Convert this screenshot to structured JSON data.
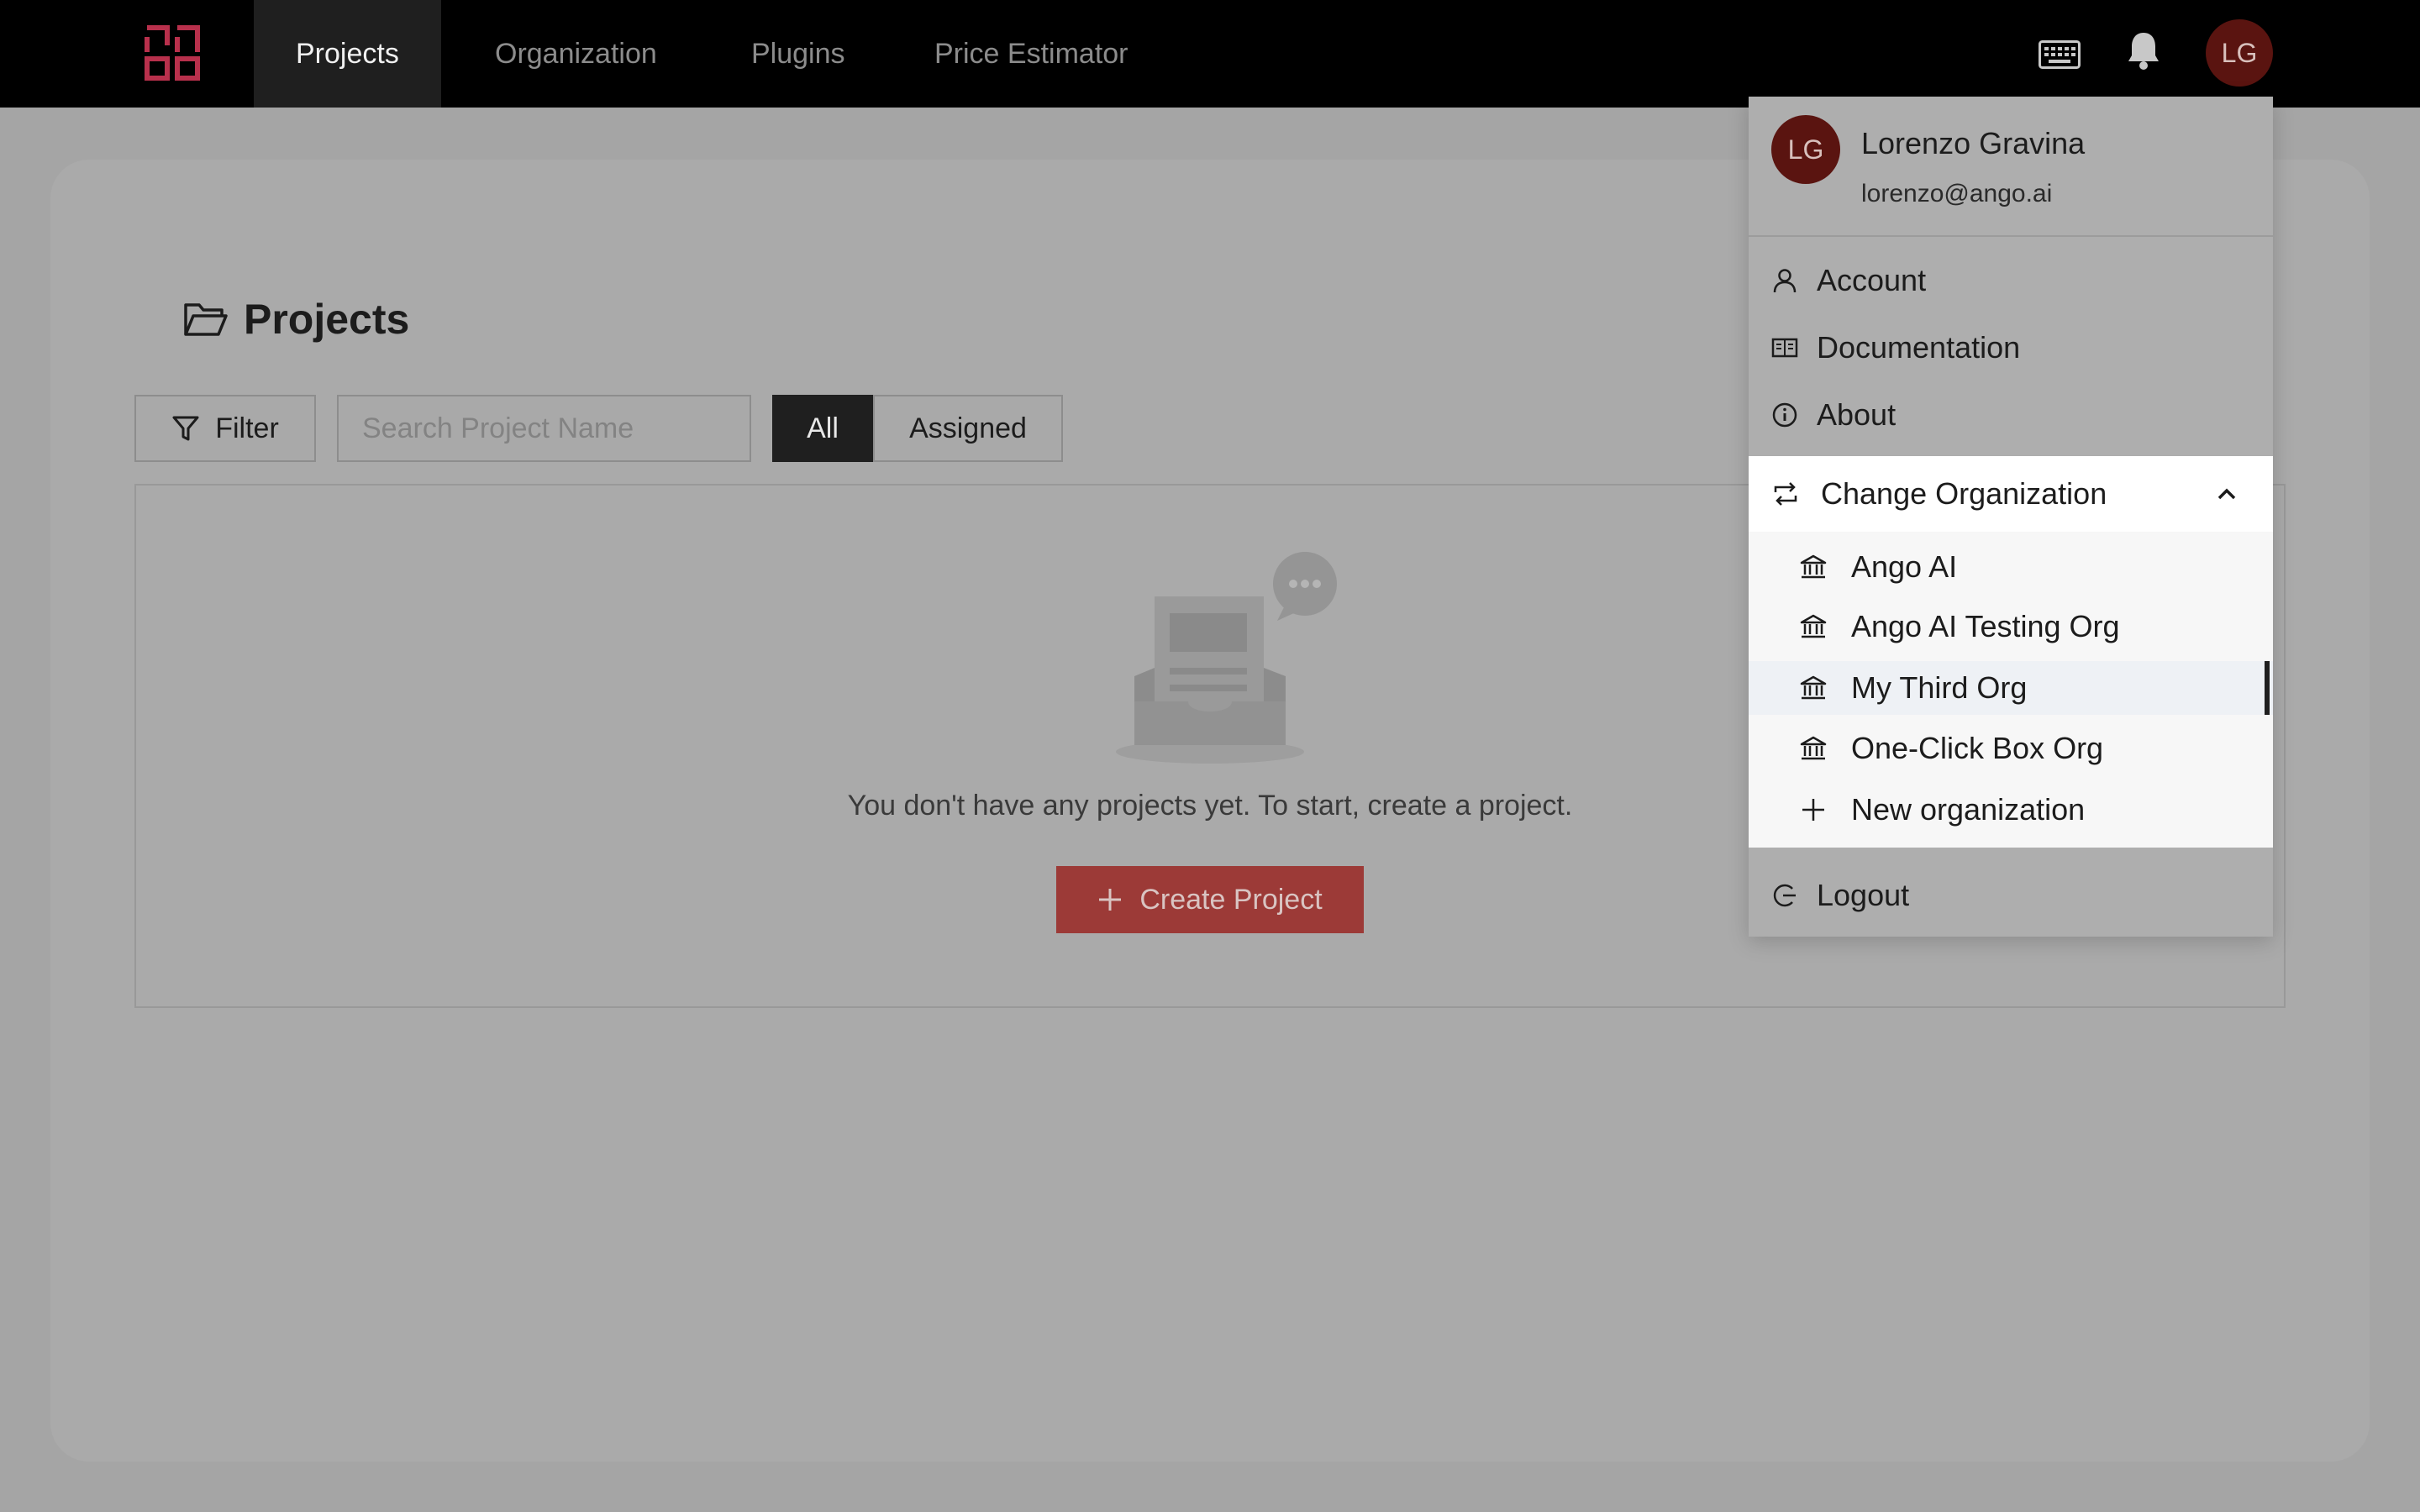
{
  "nav": {
    "items": [
      {
        "label": "Projects",
        "active": true
      },
      {
        "label": "Organization"
      },
      {
        "label": "Plugins"
      },
      {
        "label": "Price Estimator"
      }
    ],
    "user_initials": "LG",
    "icons": [
      "logo-icon",
      "keyboard-icon",
      "bell-icon"
    ]
  },
  "page": {
    "title": "Projects",
    "filter_label": "Filter",
    "search_placeholder": "Search Project Name",
    "segments": {
      "all": "All",
      "assigned": "Assigned",
      "selected": "All"
    },
    "empty_message": "You don't have any projects yet. To start, create a project.",
    "create_label": "Create Project"
  },
  "user_menu": {
    "initials": "LG",
    "name": "Lorenzo Gravina",
    "email": "lorenzo@ango.ai",
    "items": {
      "account": "Account",
      "documentation": "Documentation",
      "about": "About"
    },
    "change_org": {
      "label": "Change Organization",
      "expanded": true,
      "orgs": [
        "Ango AI",
        "Ango AI Testing Org",
        "My Third Org",
        "One-Click Box Org"
      ],
      "highlighted": "My Third Org",
      "new_org": "New organization"
    },
    "logout": "Logout"
  },
  "colors": {
    "topbar": "#000000",
    "avatar": "#5a1410",
    "logo": "#b8304c",
    "create_button": "#9c3a37"
  }
}
